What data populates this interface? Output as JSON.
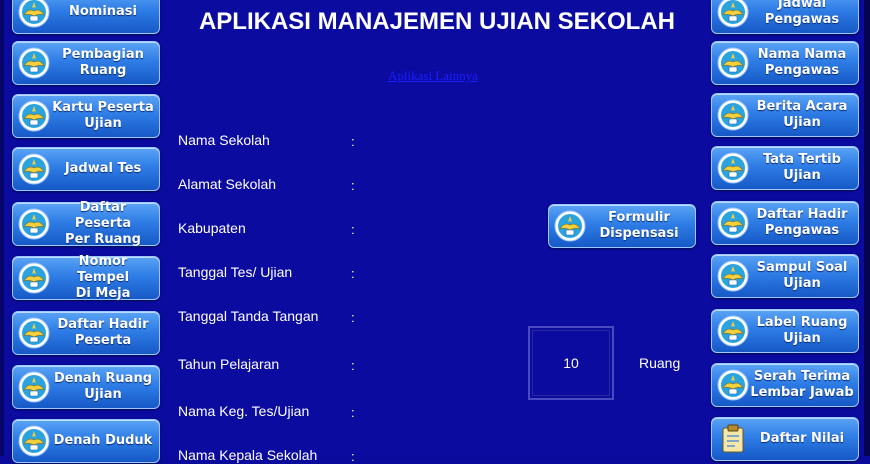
{
  "app_title": "APLIKASI MANAJEMEN UJIAN SEKOLAH",
  "link_text": "Aplikasi Lainnya",
  "left_menu": [
    {
      "label": "Nominasi"
    },
    {
      "label": "Pembagian\nRuang"
    },
    {
      "label": "Kartu Peserta\nUjian"
    },
    {
      "label": "Jadwal Tes"
    },
    {
      "label": "Daftar Peserta\nPer Ruang"
    },
    {
      "label": "Nomor Tempel\nDi Meja"
    },
    {
      "label": "Daftar Hadir\nPeserta"
    },
    {
      "label": "Denah Ruang\nUjian"
    },
    {
      "label": "Denah Duduk"
    }
  ],
  "right_menu": [
    {
      "label": "Jadwal\nPengawas"
    },
    {
      "label": "Nama Nama\nPengawas"
    },
    {
      "label": "Berita Acara\nUjian"
    },
    {
      "label": "Tata Tertib\nUjian"
    },
    {
      "label": "Daftar Hadir\nPengawas"
    },
    {
      "label": "Sampul Soal\nUjian"
    },
    {
      "label": "Label Ruang\nUjian"
    },
    {
      "label": "Serah Terima\nLembar Jawab"
    },
    {
      "label": "Daftar Nilai"
    }
  ],
  "center_button": {
    "label": "Formulir\nDispensasi"
  },
  "form_fields": [
    {
      "label": "Nama Sekolah",
      "value": ""
    },
    {
      "label": "Alamat Sekolah",
      "value": ""
    },
    {
      "label": "Kabupaten",
      "value": ""
    },
    {
      "label": "Tanggal Tes/ Ujian",
      "value": ""
    },
    {
      "label": "Tanggal Tanda Tangan",
      "value": ""
    },
    {
      "label": "Tahun Pelajaran",
      "value": ""
    },
    {
      "label": "Nama Keg. Tes/Ujian",
      "value": ""
    },
    {
      "label": "Nama Kepala Sekolah",
      "value": ""
    }
  ],
  "colon": ":",
  "room_count": "10",
  "room_label": "Ruang",
  "colors": {
    "background": "#0b0ba0",
    "button": "#2f7de6",
    "link": "#1d1dff"
  },
  "icons": {
    "menu": "tut-wuri-handayani-logo",
    "report": "clipboard-icon"
  }
}
